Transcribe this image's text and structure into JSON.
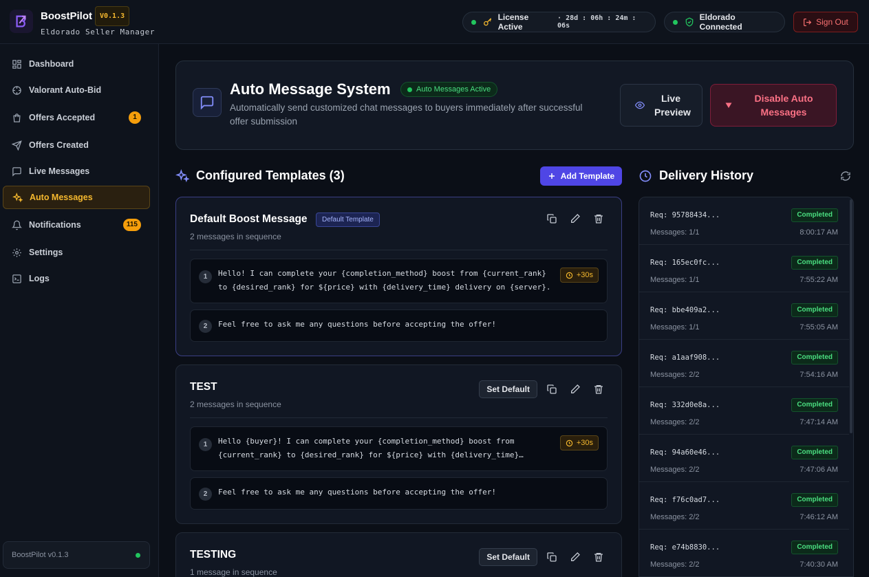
{
  "header": {
    "brand": "BoostPilot",
    "version": "V0.1.3",
    "subtitle": "Eldorado Seller Manager",
    "license_label": "License Active",
    "license_timer": "· 28d : 06h : 24m : 06s",
    "connection_label": "Eldorado Connected",
    "signout_label": "Sign Out"
  },
  "sidebar": {
    "items": [
      {
        "label": "Dashboard",
        "icon": "dashboard-icon"
      },
      {
        "label": "Valorant Auto-Bid",
        "icon": "crosshair-icon"
      },
      {
        "label": "Offers Accepted",
        "icon": "bag-icon",
        "badge": "1"
      },
      {
        "label": "Offers Created",
        "icon": "send-icon"
      },
      {
        "label": "Live Messages",
        "icon": "chat-icon"
      },
      {
        "label": "Auto Messages",
        "icon": "sparkles-icon",
        "active": true
      },
      {
        "label": "Notifications",
        "icon": "bell-icon",
        "badge": "115"
      },
      {
        "label": "Settings",
        "icon": "gear-icon"
      },
      {
        "label": "Logs",
        "icon": "terminal-icon"
      }
    ],
    "footer_version": "BoostPilot v0.1.3"
  },
  "hero": {
    "title": "Auto Message System",
    "status_badge": "Auto Messages Active",
    "description": "Automatically send customized chat messages to buyers immediately after successful offer submission",
    "preview_button": "Live Preview",
    "disable_button": "Disable Auto Messages"
  },
  "templates": {
    "section_title": "Configured Templates (3)",
    "add_button": "Add Template",
    "default_tag": "Default Template",
    "set_default_label": "Set Default",
    "items": [
      {
        "name": "Default Boost Message",
        "subtitle": "2 messages in sequence",
        "messages": [
          {
            "num": "1",
            "line1": "Hello! I can complete your {completion_method} boost from {current_rank}",
            "line2": "to {desired_rank} for ${price} with {delivery_time} delivery on {server}.",
            "delay": "+30s"
          },
          {
            "num": "2",
            "line1": "Feel free to ask me any questions before accepting the offer!"
          }
        ]
      },
      {
        "name": "TEST",
        "subtitle": "2 messages in sequence",
        "messages": [
          {
            "num": "1",
            "line1": "Hello {buyer}! I can complete your {completion_method} boost from",
            "line2": "{current_rank} to {desired_rank} for ${price} with {delivery_time}…",
            "delay": "+30s"
          },
          {
            "num": "2",
            "line1": "Feel free to ask me any questions before accepting the offer!"
          }
        ]
      },
      {
        "name": "TESTING",
        "subtitle": "1 message in sequence"
      }
    ]
  },
  "history": {
    "title": "Delivery History",
    "rows": [
      {
        "req": "Req: 95788434...",
        "messages": "Messages: 1/1",
        "status": "Completed",
        "time": "8:00:17 AM"
      },
      {
        "req": "Req: 165ec0fc...",
        "messages": "Messages: 1/1",
        "status": "Completed",
        "time": "7:55:22 AM"
      },
      {
        "req": "Req: bbe409a2...",
        "messages": "Messages: 1/1",
        "status": "Completed",
        "time": "7:55:05 AM"
      },
      {
        "req": "Req: a1aaf908...",
        "messages": "Messages: 2/2",
        "status": "Completed",
        "time": "7:54:16 AM"
      },
      {
        "req": "Req: 332d0e8a...",
        "messages": "Messages: 2/2",
        "status": "Completed",
        "time": "7:47:14 AM"
      },
      {
        "req": "Req: 94a60e46...",
        "messages": "Messages: 2/2",
        "status": "Completed",
        "time": "7:47:06 AM"
      },
      {
        "req": "Req: f76c0ad7...",
        "messages": "Messages: 2/2",
        "status": "Completed",
        "time": "7:46:12 AM"
      },
      {
        "req": "Req: e74b8830...",
        "messages": "Messages: 2/2",
        "status": "Completed",
        "time": "7:40:30 AM"
      }
    ]
  },
  "colors": {
    "accent": "#f5b82e",
    "primary": "#4f46e5",
    "success": "#22c55e",
    "danger": "#f87171"
  }
}
